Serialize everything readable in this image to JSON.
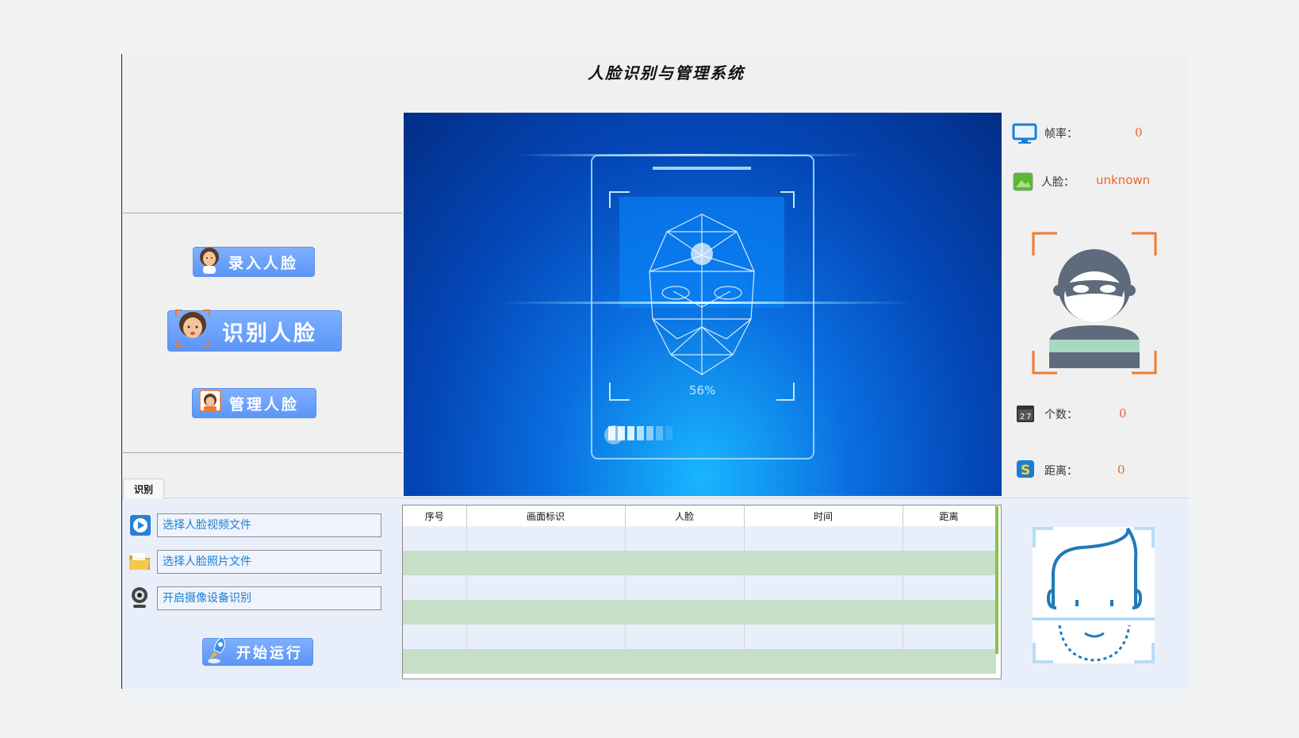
{
  "window": {
    "title": "人脸识别与管理系统"
  },
  "buttons": {
    "enroll": "录入人脸",
    "recognize": "识别人脸",
    "manage": "管理人脸",
    "start": "开始运行"
  },
  "tab": {
    "label": "识别"
  },
  "sources": [
    {
      "label": "选择人脸视频文件",
      "icon": "play-icon"
    },
    {
      "label": "选择人脸照片文件",
      "icon": "folder-icon"
    },
    {
      "label": "开启摄像设备识别",
      "icon": "webcam-icon"
    }
  ],
  "main_view": {
    "progress_text": "56%"
  },
  "info": {
    "fps_label": "帧率：",
    "fps_value": "0",
    "face_label": "人脸：",
    "face_value": "unknown",
    "count_label": "个数：",
    "count_value": "0",
    "distance_label": "距离：",
    "distance_value": "0"
  },
  "table": {
    "columns": [
      "序号",
      "画面标识",
      "人脸",
      "时间",
      "距离"
    ],
    "rows": [
      [
        "",
        "",
        "",
        "",
        ""
      ],
      [
        "",
        "",
        "",
        "",
        ""
      ],
      [
        "",
        "",
        "",
        "",
        ""
      ],
      [
        "",
        "",
        "",
        "",
        ""
      ],
      [
        "",
        "",
        "",
        "",
        ""
      ],
      [
        "",
        "",
        "",
        "",
        ""
      ]
    ]
  },
  "colors": {
    "accent": "#e8662b",
    "button": "#6aa1fb",
    "row_alt": "#c5e0c7"
  }
}
